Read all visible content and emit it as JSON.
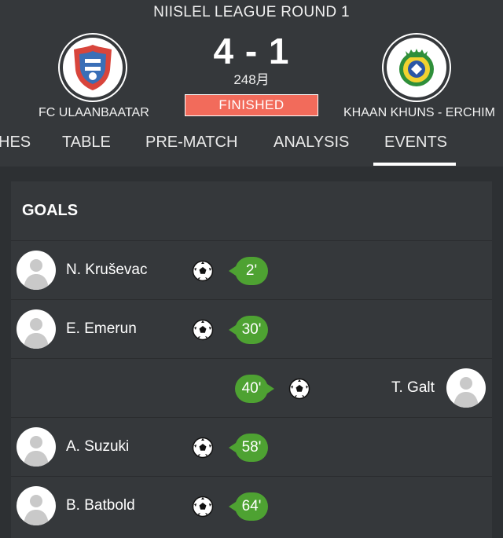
{
  "match": {
    "league_round": "NIISLEL LEAGUE ROUND 1",
    "score": "4 - 1",
    "date": "248月",
    "status": "FINISHED",
    "home_team": "FC ULAANBAATAR",
    "away_team": "KHAAN KHUNS - ERCHIM"
  },
  "tabs": [
    "HES",
    "TABLE",
    "PRE-MATCH",
    "ANALYSIS",
    "EVENTS"
  ],
  "active_tab": "EVENTS",
  "events": {
    "section_title": "GOALS",
    "goals": [
      {
        "player": "N. Kruševac",
        "minute": "2'",
        "side": "home"
      },
      {
        "player": "E. Emerun",
        "minute": "30'",
        "side": "home"
      },
      {
        "player": "T. Galt",
        "minute": "40'",
        "side": "away"
      },
      {
        "player": "A. Suzuki",
        "minute": "58'",
        "side": "home"
      },
      {
        "player": "B. Batbold",
        "minute": "64'",
        "side": "home"
      }
    ]
  },
  "colors": {
    "background": "#2d3033",
    "panel": "#35383b",
    "status_badge": "#f26b5b",
    "minute_badge": "#4ea232",
    "home_logo_accent": "#d8453c",
    "away_logo_accent": "#2f8f3a"
  },
  "icons": {
    "goal": "soccer-ball-icon",
    "player": "player-avatar-icon"
  }
}
